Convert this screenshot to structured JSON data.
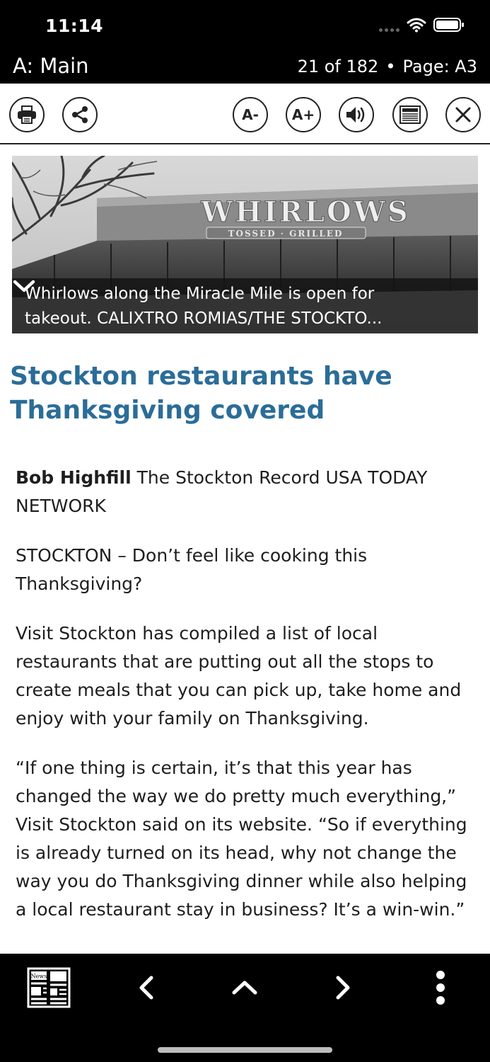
{
  "status_bar": {
    "time": "11:14"
  },
  "title_bar": {
    "section": "A: Main",
    "position": "21 of 182",
    "separator": "•",
    "page": "Page: A3"
  },
  "toolbar": {
    "print_icon": "printer-icon",
    "share_icon": "share-icon",
    "font_decrease_label": "A-",
    "font_increase_label": "A+",
    "audio_icon": "speaker-icon",
    "page_view_icon": "newspaper-icon",
    "close_icon": "close-icon"
  },
  "photo": {
    "sign_text": "WHIRLOWS",
    "sign_subtext": "TOSSED · GRILLED",
    "caption_line1": "Whirlows along the Miracle Mile is open for",
    "caption_line2": "takeout. CALIXTRO ROMIAS/THE STOCKTO..."
  },
  "article": {
    "headline_line1": "Stockton restaurants have",
    "headline_line2": "Thanksgiving covered",
    "byline_name": "Bob Highfill",
    "byline_rest": "The Stockton Record USA TODAY NETWORK",
    "paragraphs": [
      "STOCKTON – Don’t feel like cooking this Thanksgiving?",
      "Visit Stockton has compiled a list of local restaurants that are putting out all the stops to create meals that you can pick up, take home and enjoy with your family on Thanksgiving.",
      "“If one thing is certain, it’s that this year has changed the way we do pretty much everything,” Visit Stockton said on its website. “So if everything is already turned on its head, why not change the way you do Thanksgiving dinner while also helping a local restaurant stay in business? It’s a win-win.”"
    ]
  },
  "bottom_nav": {
    "newspaper_label": "News",
    "prev_icon": "chevron-left-icon",
    "up_icon": "chevron-up-icon",
    "next_icon": "chevron-right-icon",
    "more_icon": "more-vertical-icon"
  }
}
